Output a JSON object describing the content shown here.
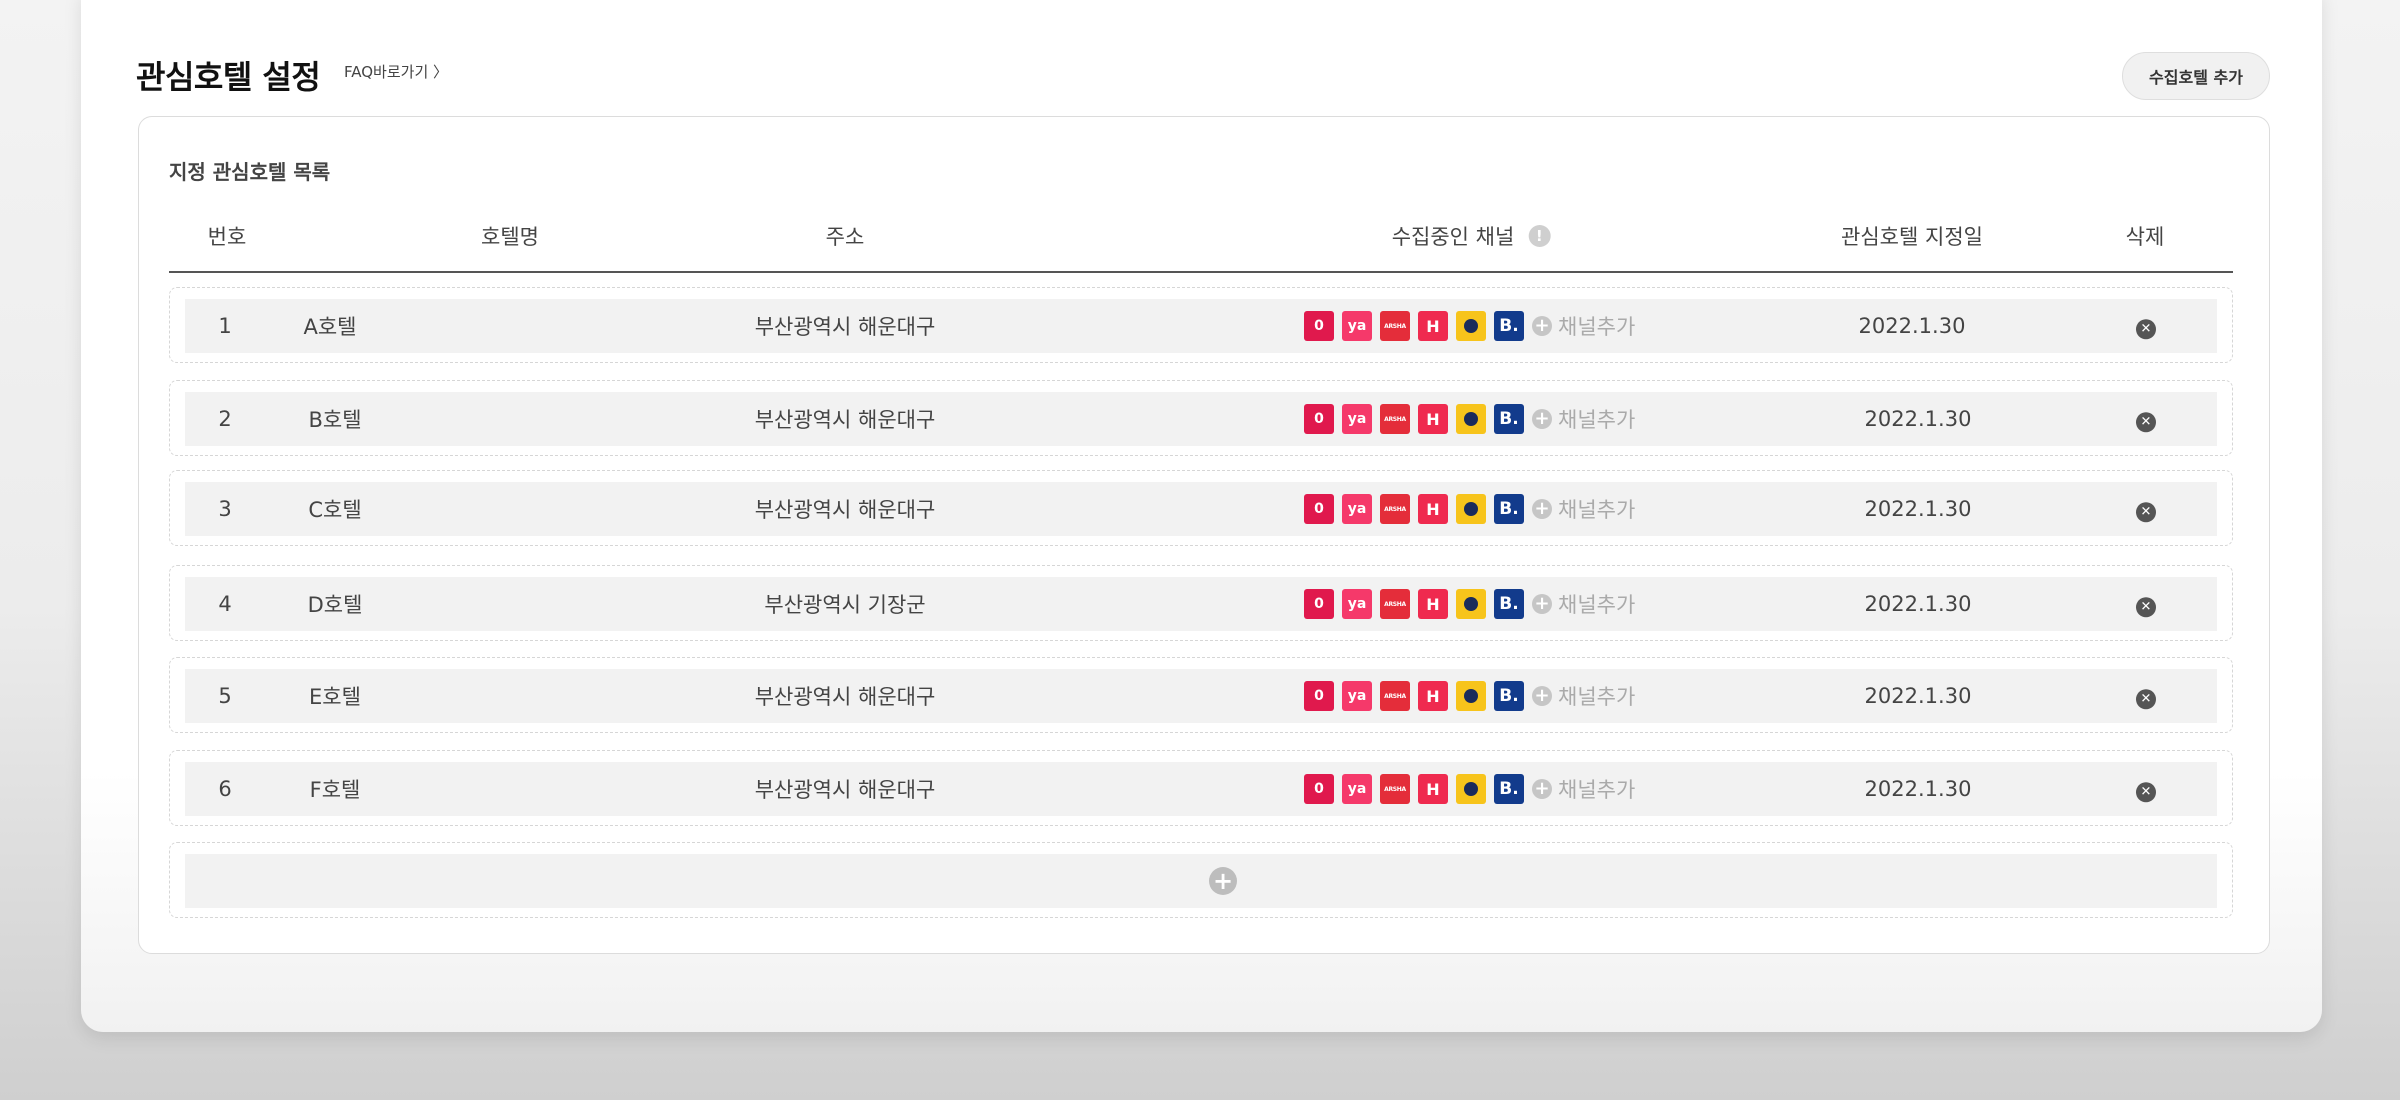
{
  "header": {
    "title": "관심호텔 설정",
    "faq_link": "FAQ바로가기 〉",
    "add_button": "수집호텔 추가"
  },
  "list": {
    "title": "지정 관심호텔 목록",
    "columns": {
      "no": "번호",
      "name": "호텔명",
      "address": "주소",
      "channels": "수집중인 채널",
      "date": "관심호텔 지정일",
      "delete": "삭제"
    },
    "add_channel_label": "채널추가",
    "rows": [
      {
        "no": "1",
        "name": "A호텔",
        "address": "부산광역시 해운대구",
        "date": "2022.1.30"
      },
      {
        "no": "2",
        "name": "B호텔",
        "address": "부산광역시 해운대구",
        "date": "2022.1.30"
      },
      {
        "no": "3",
        "name": "C호텔",
        "address": "부산광역시 해운대구",
        "date": "2022.1.30"
      },
      {
        "no": "4",
        "name": "D호텔",
        "address": "부산광역시 기장군",
        "date": "2022.1.30"
      },
      {
        "no": "5",
        "name": "E호텔",
        "address": "부산광역시 해운대구",
        "date": "2022.1.30"
      },
      {
        "no": "6",
        "name": "F호텔",
        "address": "부산광역시 해운대구",
        "date": "2022.1.30"
      }
    ]
  },
  "channel_icons": [
    {
      "icon": "channel-1-icon",
      "glyph": "0",
      "color": "#e0194d"
    },
    {
      "icon": "channel-ya-icon",
      "glyph": "ya",
      "color": "#f5396a"
    },
    {
      "icon": "channel-3-icon",
      "glyph": "",
      "color": "#e42d3a"
    },
    {
      "icon": "channel-h-icon",
      "glyph": "H",
      "color": "#ef2a4f"
    },
    {
      "icon": "channel-expedia-icon",
      "glyph": "",
      "color": "#f7c41b"
    },
    {
      "icon": "channel-booking-icon",
      "glyph": "B.",
      "color": "#123b8c"
    }
  ],
  "icons": {
    "info": "info-icon",
    "add": "plus-circle-icon",
    "delete": "close-circle-icon"
  }
}
